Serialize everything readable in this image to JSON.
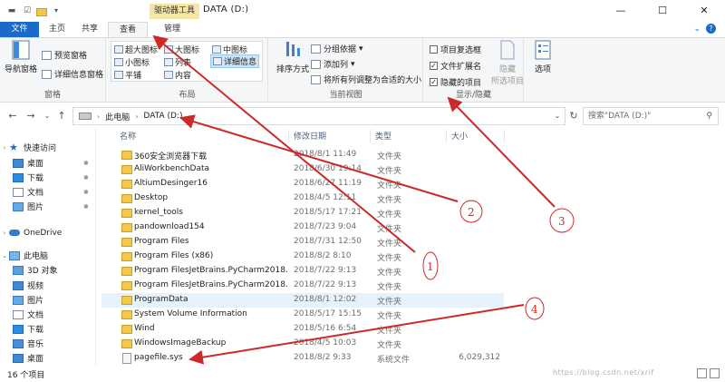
{
  "titlebar": {
    "context_tab": "驱动器工具",
    "title": "DATA (D:)",
    "minimize": "—",
    "maximize": "☐",
    "close": "✕"
  },
  "tabs": {
    "file": "文件",
    "home": "主页",
    "share": "共享",
    "view": "查看",
    "manage": "管理",
    "active": "查看"
  },
  "ribbon": {
    "panes": {
      "nav_pane": "导航窗格",
      "preview": "预览窗格",
      "details_pane": "详细信息窗格",
      "label": "窗格"
    },
    "layout": {
      "extra_large": "超大图标",
      "large": "大图标",
      "medium": "中图标",
      "small": "小图标",
      "list": "列表",
      "details": "详细信息",
      "tiles": "平铺",
      "content": "内容",
      "selected": "详细信息",
      "label": "布局"
    },
    "current_view": {
      "sort": "排序方式",
      "group_by": "分组依据",
      "add_column": "添加列",
      "fit_columns": "将所有列调整为合适的大小",
      "label": "当前视图"
    },
    "show_hide": {
      "item_checkboxes": "项目复选框",
      "file_extensions": "文件扩展名",
      "hidden_items": "隐藏的项目",
      "item_checkboxes_checked": false,
      "file_extensions_checked": true,
      "hidden_items_checked": true,
      "hide_selected_line1": "隐藏",
      "hide_selected_line2": "所选项目",
      "label": "显示/隐藏"
    },
    "options": "选项"
  },
  "addressbar": {
    "crumbs": [
      "此电脑",
      "DATA (D:)"
    ],
    "search_placeholder": "搜索\"DATA (D:)\""
  },
  "navpane": {
    "items": [
      {
        "label": "快速访问",
        "icon": "star-icon"
      },
      {
        "label": "桌面",
        "icon": "desktop-icon",
        "pinned": true
      },
      {
        "label": "下载",
        "icon": "download-icon",
        "pinned": true
      },
      {
        "label": "文档",
        "icon": "document-icon",
        "pinned": true
      },
      {
        "label": "图片",
        "icon": "pictures-icon",
        "pinned": true
      },
      {
        "label": "OneDrive",
        "icon": "onedrive-icon"
      },
      {
        "label": "此电脑",
        "icon": "computer-icon"
      },
      {
        "label": "3D 对象",
        "icon": "3d-objects-icon"
      },
      {
        "label": "视频",
        "icon": "videos-icon"
      },
      {
        "label": "图片",
        "icon": "pictures-icon"
      },
      {
        "label": "文档",
        "icon": "document-icon"
      },
      {
        "label": "下载",
        "icon": "download-icon"
      },
      {
        "label": "音乐",
        "icon": "music-icon"
      },
      {
        "label": "桌面",
        "icon": "desktop-icon"
      }
    ]
  },
  "filelist": {
    "columns": [
      "名称",
      "修改日期",
      "类型",
      "大小"
    ],
    "rows": [
      {
        "name": "360安全浏览器下载",
        "date": "2018/8/1 11:49",
        "type": "文件夹",
        "size": ""
      },
      {
        "name": "AliWorkbenchData",
        "date": "2018/6/30 19:14",
        "type": "文件夹",
        "size": ""
      },
      {
        "name": "AltiumDesinger16",
        "date": "2018/6/27 11:19",
        "type": "文件夹",
        "size": ""
      },
      {
        "name": "Desktop",
        "date": "2018/4/5 12:11",
        "type": "文件夹",
        "size": ""
      },
      {
        "name": "kernel_tools",
        "date": "2018/5/17 17:21",
        "type": "文件夹",
        "size": ""
      },
      {
        "name": "pandownload154",
        "date": "2018/7/23 9:04",
        "type": "文件夹",
        "size": ""
      },
      {
        "name": "Program Files",
        "date": "2018/7/31 12:50",
        "type": "文件夹",
        "size": ""
      },
      {
        "name": "Program Files (x86)",
        "date": "2018/8/2 8:10",
        "type": "文件夹",
        "size": ""
      },
      {
        "name": "Program FilesJetBrains.PyCharm2018...",
        "date": "2018/7/22 9:13",
        "type": "文件夹",
        "size": ""
      },
      {
        "name": "Program FilesJetBrains.PyCharm2018...",
        "date": "2018/7/22 9:13",
        "type": "文件夹",
        "size": ""
      },
      {
        "name": "ProgramData",
        "date": "2018/8/1 12:02",
        "type": "文件夹",
        "size": "",
        "selected": true
      },
      {
        "name": "System Volume Information",
        "date": "2018/5/17 15:15",
        "type": "文件夹",
        "size": ""
      },
      {
        "name": "Wind",
        "date": "2018/5/16 6:54",
        "type": "文件夹",
        "size": ""
      },
      {
        "name": "WindowsImageBackup",
        "date": "2018/4/5 10:03",
        "type": "文件夹",
        "size": ""
      },
      {
        "name": "pagefile.sys",
        "date": "2018/8/2 9:33",
        "type": "系统文件",
        "size": "6,029,312",
        "system": true
      }
    ]
  },
  "statusbar": {
    "count": "16 个项目",
    "watermark": "https://blog.csdn.net/xrif"
  },
  "annotations": {
    "color": "#cc2a2a",
    "labels": [
      "1",
      "2",
      "3",
      "4"
    ]
  }
}
